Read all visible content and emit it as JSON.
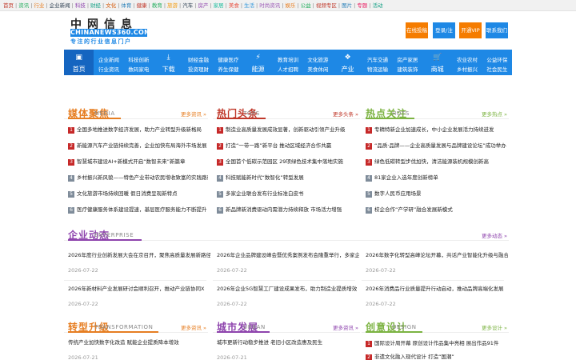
{
  "topbar": {
    "links": [
      {
        "text": "首页",
        "color": "#c0392b"
      },
      {
        "text": "资讯",
        "color": "#27ae60"
      },
      {
        "text": "行业",
        "color": "#e67e22"
      },
      {
        "text": "企业新闻",
        "color": "#2c3e50"
      },
      {
        "text": "科技",
        "color": "#8e44ad"
      },
      {
        "text": "财经",
        "color": "#16a085"
      },
      {
        "text": "文化",
        "color": "#d35400"
      },
      {
        "text": "体育",
        "color": "#2980b9"
      },
      {
        "text": "健康",
        "color": "#c0392b"
      },
      {
        "text": "教育",
        "color": "#27ae60"
      },
      {
        "text": "旅游",
        "color": "#f39c12"
      },
      {
        "text": "汽车",
        "color": "#2c3e50"
      },
      {
        "text": "房产",
        "color": "#8e44ad"
      },
      {
        "text": "家居",
        "color": "#1abc9c"
      },
      {
        "text": "美食",
        "color": "#e74c3c"
      },
      {
        "text": "生活",
        "color": "#3498db"
      },
      {
        "text": "时尚资讯",
        "color": "#9b59b6"
      },
      {
        "text": "娱乐",
        "color": "#e67e22"
      },
      {
        "text": "公益",
        "color": "#27ae60"
      },
      {
        "text": "视频专区",
        "color": "#c0392b"
      },
      {
        "text": "图片",
        "color": "#2980b9"
      },
      {
        "text": "专题",
        "color": "#e91e63"
      },
      {
        "text": "活动",
        "color": "#16a085"
      }
    ]
  },
  "header": {
    "logo_cn": "中网信息",
    "logo_en": "CHINANEWS360.COM",
    "logo_sub": "专注的行业信息门户",
    "buttons": [
      {
        "label": "在线投稿",
        "color": "#f57c00"
      },
      {
        "label": "登录/注册",
        "color": "#1e88e5"
      },
      {
        "label": "开通VIP",
        "color": "#f57c00"
      },
      {
        "label": "联系我们",
        "color": "#1e88e5"
      }
    ]
  },
  "nav": [
    {
      "type": "icon",
      "icon": "monitor-icon",
      "glyph": "▣",
      "label": "首页",
      "active": true
    },
    {
      "type": "text",
      "l1": "企业新闻",
      "l2": "行业资讯"
    },
    {
      "type": "text",
      "l1": "科技创新",
      "l2": "数码家电"
    },
    {
      "type": "icon",
      "icon": "download-icon",
      "glyph": "⤓",
      "label": "下载"
    },
    {
      "type": "text",
      "l1": "财经金融",
      "l2": "投资理财"
    },
    {
      "type": "text",
      "l1": "健康医疗",
      "l2": "养生保健"
    },
    {
      "type": "icon",
      "icon": "plug-icon",
      "glyph": "⚡",
      "label": "能源"
    },
    {
      "type": "text",
      "l1": "教育培训",
      "l2": "人才招聘"
    },
    {
      "type": "text",
      "l1": "文化旅游",
      "l2": "美食休闲"
    },
    {
      "type": "icon",
      "icon": "cubes-icon",
      "glyph": "❖",
      "label": "产业"
    },
    {
      "type": "text",
      "l1": "汽车交通",
      "l2": "物流运输"
    },
    {
      "type": "text",
      "l1": "房产家居",
      "l2": "建筑装饰"
    },
    {
      "type": "icon",
      "icon": "cart-icon",
      "glyph": "🛒",
      "label": "商城"
    },
    {
      "type": "text",
      "l1": "农业农村",
      "l2": "乡村振兴"
    },
    {
      "type": "text",
      "l1": "公益环保",
      "l2": "社会民生"
    }
  ],
  "sections": {
    "media": {
      "cn": "媒体聚焦",
      "en": "MEDIA",
      "more": "更多资讯",
      "color": "#e67e22",
      "items": [
        "全国多地推进数字经济发展，助力产业转型升级新格局",
        "新能源汽车产业链持续完善，企业加快布局海外市场发展",
        "智慧城市建设AI+新模式开启“数智未来”新篇章",
        "乡村振兴新风貌——特色产业带动农民增收致富的实践路径",
        "文化旅游市场持续回暖 假日消费呈现新特点",
        "医疗健康服务体系建设提速，基层医疗服务能力不断提升"
      ]
    },
    "tops": {
      "cn": "热门头条",
      "en": "TOPS",
      "more": "更多头条",
      "color": "#c0392b",
      "items": [
        "制造业高质量发展成效显著，创新驱动引领产业升级",
        "打造“一带一路”新平台 推动区域经济合作共赢",
        "全国首个低碳示范园区 29项绿色技术集中落地实施",
        "科技赋能新时代“数智化”转型发展",
        "多家企业联合发布行业标准白皮书",
        "新品牌新消费驱动内需潜力持续释放 市场活力增强"
      ]
    },
    "hots": {
      "cn": "热点关注",
      "en": "HOTS",
      "more": "更多热点",
      "color": "#7cb342",
      "items": [
        "专精特新企业加速成长，中小企业发展活力持续迸发",
        "“品质·品牌——企业高质量发展与品牌建设论坛”成功举办",
        "绿色低碳转型步伐加快，清洁能源装机规模创新高",
        "81家企业入选年度创新榜单",
        "数字人民币应用场景",
        "校企合作“产学研”融合发展新模式"
      ]
    },
    "enterprise": {
      "cn": "企业动态",
      "en": "ENTERPRISE",
      "more": "更多动态",
      "color": "#8e44ad",
      "articles": [
        {
          "title": "2026年度行业创新发展大会在京召开，聚焦高质量发展新路径与新机遇",
          "date": "2026-07-22"
        },
        {
          "title": "2026年企业品牌建设峰会暨优秀案例发布会隆重举行，多家企业获评表彰",
          "date": "2026-07-22"
        },
        {
          "title": "2026年数字化转型高峰论坛开幕，共话产业智能化升级与融合发展",
          "date": "2026-07-22"
        },
        {
          "title": "2026年新材料产业发展研讨会顺利召开，推动产业链协同X",
          "date": "2026-07-22"
        },
        {
          "title": "2026年企业5G智慧工厂建设成果发布，助力制造业提质增效",
          "date": "2026-07-22"
        },
        {
          "title": "2026年消费品行业质量提升行动启动，推动品牌高端化发展",
          "date": "2026-07-22"
        }
      ]
    },
    "transformation": {
      "cn": "转型升级",
      "en": "TRANSFORMATION",
      "more": "更多资讯",
      "color": "#e67e22",
      "articles": [
        {
          "title": "传统产业加快数字化改造 赋能企业提质降本增效",
          "date": "2026-07-21"
        }
      ]
    },
    "urban": {
      "cn": "城市发展",
      "en": "URBAN",
      "more": "更多资讯",
      "color": "#8e44ad",
      "articles": [
        {
          "title": "城市更新行动稳步推进 老旧小区改造惠及民生",
          "date": "2026-07-21"
        }
      ]
    },
    "design": {
      "cn": "创意设计",
      "en": "DESIGN",
      "more": "更多设计",
      "color": "#7cb342",
      "items": [
        "国际设计周开幕 原创设计作品集中亮相 展出作品91件",
        "非遗文化融入现代设计 打造“国潮”"
      ]
    }
  }
}
